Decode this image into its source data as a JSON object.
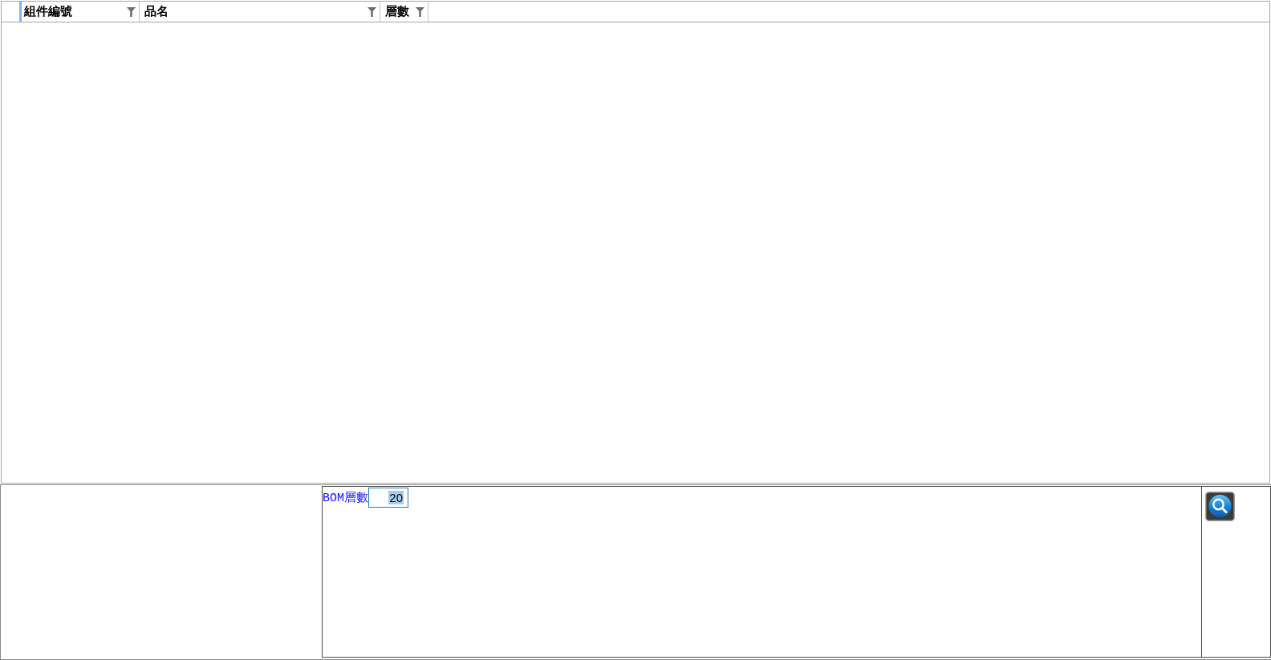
{
  "grid": {
    "columns": [
      {
        "label": "組件編號",
        "selected": true
      },
      {
        "label": "品名",
        "selected": false
      },
      {
        "label": "層數",
        "selected": false
      }
    ]
  },
  "query": {
    "label": "BOM層數",
    "value": "20",
    "value_selected": true
  }
}
